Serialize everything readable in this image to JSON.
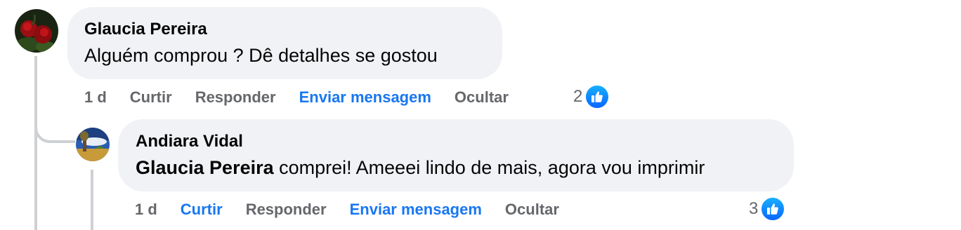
{
  "comments": [
    {
      "author": "Glaucia Pereira",
      "text": "Alguém comprou ? Dê detalhes se gostou",
      "actions": {
        "time": "1 d",
        "like": "Curtir",
        "reply": "Responder",
        "message": "Enviar mensagem",
        "hide": "Ocultar"
      },
      "reactions": "2",
      "liked": false
    },
    {
      "author": "Andiara Vidal",
      "mention": "Glaucia Pereira",
      "text": " comprei! Ameeei lindo de mais, agora vou imprimir",
      "actions": {
        "time": "1 d",
        "like": "Curtir",
        "reply": "Responder",
        "message": "Enviar mensagem",
        "hide": "Ocultar"
      },
      "reactions": "3",
      "liked": true
    }
  ],
  "colors": {
    "link": "#1877f2",
    "muted": "#65676b",
    "bubble": "#f0f2f5",
    "thread": "#ced0d4"
  },
  "icons": [
    "thumbs-up-icon"
  ]
}
